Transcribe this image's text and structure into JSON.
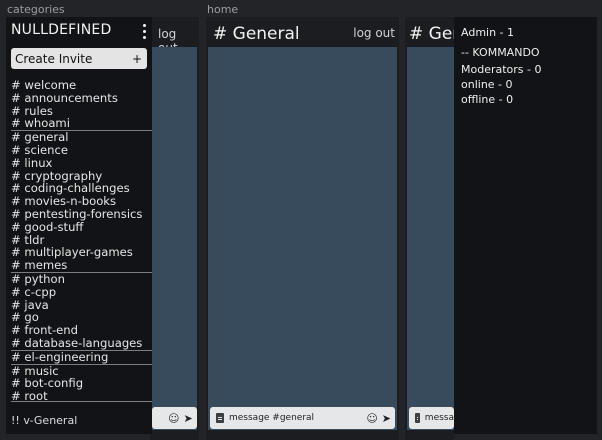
{
  "frames": {
    "left_label": "categories",
    "right_label": "home"
  },
  "sidebar": {
    "brand": "NULLDEFINED",
    "invite_label": "Create Invite",
    "invite_plus": "+",
    "groups": [
      [
        "# welcome",
        "# announcements",
        "# rules",
        "# whoami"
      ],
      [
        "# general",
        "# science",
        "# linux",
        "# cryptography",
        "# coding-challenges",
        "# movies-n-books",
        "# pentesting-forensics",
        "# good-stuff",
        "# tldr",
        "# multiplayer-games",
        "# memes"
      ],
      [
        "# python",
        "# c-cpp",
        "# java",
        "# go",
        "# front-end",
        "# database-languages"
      ],
      [
        "# el-engineering"
      ],
      [
        "# music",
        "# bot-config",
        "# root"
      ]
    ],
    "voice_channel": "!! v-General"
  },
  "back_panel": {
    "logout_label": "log out"
  },
  "main_panel": {
    "title": "# General",
    "logout_label": "log out",
    "composer_placeholder": "message #general",
    "emoji_glyph": "☺",
    "send_glyph": "➤"
  },
  "peek_panel": {
    "title_partial": "# Gen",
    "composer_partial": "messa"
  },
  "members": {
    "admin_heading": "Admin - 1",
    "admin_user": "-- KOMMANDO",
    "moderators_heading": "Moderators - 0",
    "online_heading": "online - 0",
    "offline_heading": "offline - 0"
  },
  "colors": {
    "chat_bg": "#384b5d",
    "sidebar_bg": "#111316",
    "page_bg": "#222427"
  }
}
